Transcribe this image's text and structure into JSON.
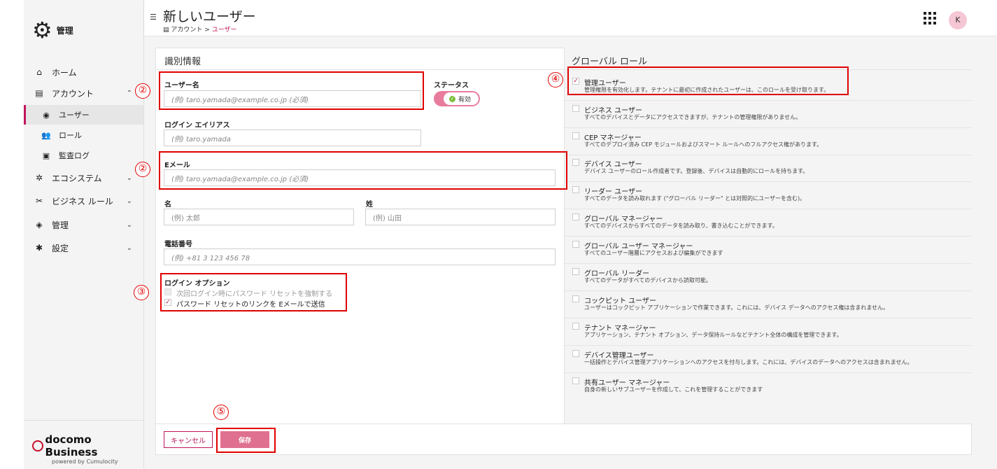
{
  "sidebar": {
    "logo_text": "管理",
    "items": [
      {
        "label": "ホーム",
        "icon": "home-icon"
      },
      {
        "label": "アカウント",
        "icon": "account-icon"
      },
      {
        "label": "エコシステム",
        "icon": "ecosystem-icon"
      },
      {
        "label": "ビジネス ルール",
        "icon": "business-rules-icon"
      },
      {
        "label": "管理",
        "icon": "admin-icon"
      },
      {
        "label": "設定",
        "icon": "settings-icon"
      }
    ],
    "subitems": [
      {
        "label": "ユーザー",
        "icon": "user-icon"
      },
      {
        "label": "ロール",
        "icon": "roles-icon"
      },
      {
        "label": "監査ログ",
        "icon": "audit-log-icon"
      }
    ],
    "brand": "docomo Business",
    "powered_by": "powered by Cumulocity"
  },
  "header": {
    "title": "新しいユーザー",
    "breadcrumb_parent": "アカウント",
    "breadcrumb_sep": ">",
    "breadcrumb_current": "ユーザー",
    "avatar_initial": "K"
  },
  "identity": {
    "section_title": "識別情報",
    "username_label": "ユーザー名",
    "username_placeholder": "(例) taro.yamada@example.co.jp (必須)",
    "status_label": "ステータス",
    "status_value": "有効",
    "alias_label": "ログイン エイリアス",
    "alias_placeholder": "(例) taro.yamada",
    "email_label": "Eメール",
    "email_placeholder": "(例) taro.yamada@example.co.jp (必須)",
    "first_name_label": "名",
    "first_name_placeholder": "(例) 太郎",
    "last_name_label": "姓",
    "last_name_placeholder": "(例) 山田",
    "phone_label": "電話番号",
    "phone_placeholder": "(例) +81 3 123 456 78",
    "login_options_label": "ログイン オプション",
    "login_option_1": "次回ログイン時にパスワード リセットを強制する",
    "login_option_2": "パスワード リセットのリンクを Eメールで送信"
  },
  "roles": {
    "section_title": "グローバル ロール",
    "items": [
      {
        "name": "管理ユーザー",
        "desc": "管理権限を有効化します。テナントに最初に作成されたユーザーは、このロールを受け取ります。",
        "checked": true
      },
      {
        "name": "ビジネス ユーザー",
        "desc": "すべてのデバイスとデータにアクセスできますが、テナントの管理権限がありません。",
        "checked": false
      },
      {
        "name": "CEP マネージャー",
        "desc": "すべてのデプロイ済み CEP モジュールおよびスマート ルールへのフルアクセス権があります。",
        "checked": false
      },
      {
        "name": "デバイス ユーザー",
        "desc": "デバイス ユーザーのロール作成者です。登録後、デバイスは自動的にロールを持ちます。",
        "checked": false
      },
      {
        "name": "リーダー ユーザー",
        "desc": "すべてのデータを読み取れます (\"グローバル リーダー\" とは対照的にユーザーを含む)。",
        "checked": false
      },
      {
        "name": "グローバル マネージャー",
        "desc": "すべてのデバイスからすべてのデータを読み取り、書き込むことができます。",
        "checked": false
      },
      {
        "name": "グローバル ユーザー マネージャー",
        "desc": "すべてのユーザー階層にアクセスおよび編集ができます",
        "checked": false
      },
      {
        "name": "グローバル リーダー",
        "desc": "すべてのデータがすべてのデバイスから読取可能。",
        "checked": false
      },
      {
        "name": "コックピット ユーザー",
        "desc": "ユーザーはコックピット アプリケーションで作業できます。これには、デバイス データへのアクセス権は含まれません。",
        "checked": false
      },
      {
        "name": "テナント マネージャー",
        "desc": "アプリケーション、テナント オプション、データ保持ルールなどテナント全体の構成を管理できます。",
        "checked": false
      },
      {
        "name": "デバイス管理ユーザー",
        "desc": "一括操作とデバイス管理アプリケーションへのアクセスを付与します。これには、デバイスのデータへのアクセスは含まれません。",
        "checked": false
      },
      {
        "name": "共有ユーザー マネージャー",
        "desc": "自身の新しいサブユーザーを作成して、これを管理することができます",
        "checked": false
      }
    ]
  },
  "footer": {
    "cancel_label": "キャンセル",
    "save_label": "保存"
  },
  "annotations": {
    "mark_2": "②",
    "mark_3": "③",
    "mark_4": "④",
    "mark_5": "⑤"
  }
}
